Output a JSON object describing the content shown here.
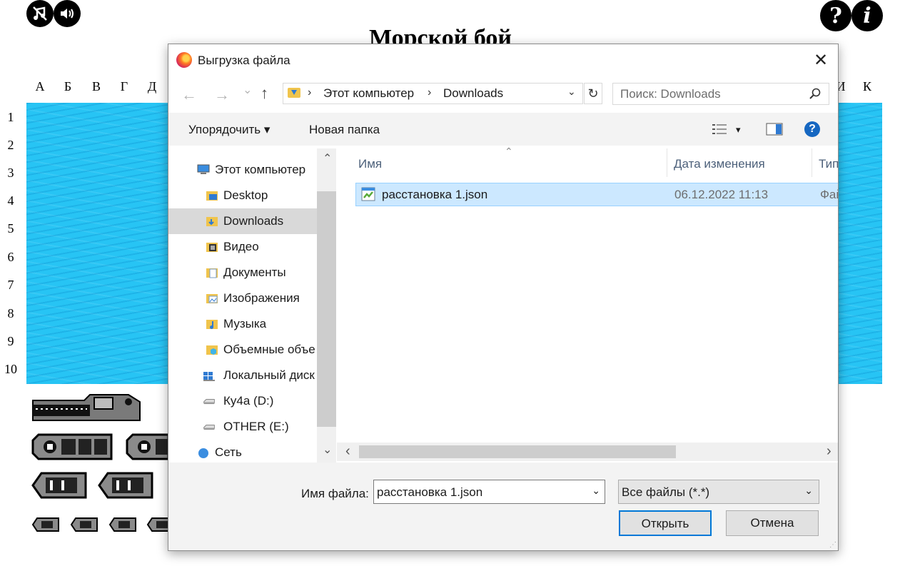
{
  "game": {
    "title": "Морской бой",
    "columns": [
      "А",
      "Б",
      "В",
      "Г",
      "Д",
      "И",
      "К"
    ],
    "rows": [
      "1",
      "2",
      "3",
      "4",
      "5",
      "6",
      "7",
      "8",
      "9",
      "10"
    ],
    "help_label": "?",
    "info_label": "i",
    "sea_color": "#27c4f4"
  },
  "dialog": {
    "title": "Выгрузка файла",
    "close_label": "✕",
    "nav": {
      "back": "←",
      "forward": "→",
      "recent": "⌄",
      "up": "↑",
      "sep": "›",
      "breadcrumb": [
        "Этот компьютер",
        "Downloads"
      ],
      "dropdown": "⌄",
      "refresh": "↻"
    },
    "search": {
      "placeholder": "Поиск: Downloads"
    },
    "toolbar": {
      "organize": "Упорядочить ▾",
      "new_folder": "Новая папка",
      "view_drop": "▾",
      "help": "?"
    },
    "sidebar": {
      "items": [
        {
          "label": "Этот компьютер",
          "icon": "computer-icon"
        },
        {
          "label": "Desktop",
          "icon": "desktop-folder-icon"
        },
        {
          "label": "Downloads",
          "icon": "downloads-folder-icon"
        },
        {
          "label": "Видео",
          "icon": "video-folder-icon"
        },
        {
          "label": "Документы",
          "icon": "documents-folder-icon"
        },
        {
          "label": "Изображения",
          "icon": "pictures-folder-icon"
        },
        {
          "label": "Музыка",
          "icon": "music-folder-icon"
        },
        {
          "label": "Объемные объе",
          "icon": "3d-objects-folder-icon"
        },
        {
          "label": "Локальный диск",
          "icon": "local-disk-icon"
        },
        {
          "label": "Ку4а (D:)",
          "icon": "drive-icon"
        },
        {
          "label": "OTHER (E:)",
          "icon": "drive-icon"
        },
        {
          "label": "Сеть",
          "icon": "network-icon"
        }
      ],
      "scroll_up": "⌃",
      "scroll_down": "⌄"
    },
    "list": {
      "sort_indicator": "⌃",
      "columns": [
        "Имя",
        "Дата изменения",
        "Тип"
      ],
      "files": [
        {
          "name": "расстановка 1.json",
          "date": "06.12.2022 11:13",
          "type": "Фай"
        }
      ],
      "scroll_left": "‹",
      "scroll_right": "›"
    },
    "bottom": {
      "filename_label": "Имя файла:",
      "filename_value": "расстановка 1.json",
      "filetype_value": "Все файлы (*.*)",
      "dropdown": "⌄",
      "open_label": "Открыть",
      "cancel_label": "Отмена"
    }
  }
}
